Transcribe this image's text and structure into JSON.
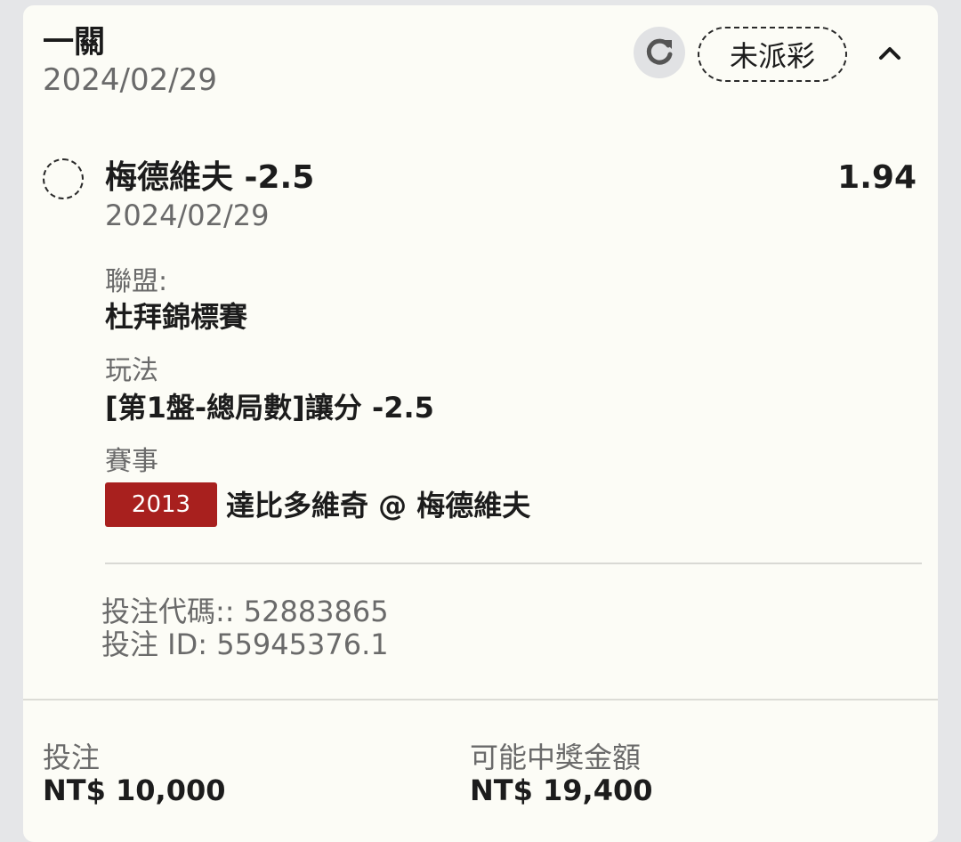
{
  "header": {
    "title": "一關",
    "date": "2024/02/29",
    "status": "未派彩",
    "refresh_icon": "refresh-icon",
    "collapse_icon": "chevron-up-icon"
  },
  "selection": {
    "name": "梅德維夫 -2.5",
    "date": "2024/02/29",
    "odds": "1.94",
    "league_label": "聯盟:",
    "league_value": "杜拜錦標賽",
    "market_label": "玩法",
    "market_value": "[第1盤-總局數]讓分 -2.5",
    "event_label": "賽事",
    "event_id": "2013",
    "event_name": "達比多維奇 @ 梅德維夫"
  },
  "bet_info": {
    "code_line": "投注代碼:: 52883865",
    "id_line": "投注 ID: 55945376.1"
  },
  "footer": {
    "stake_label": "投注",
    "stake_value": "NT$ 10,000",
    "payout_label": "可能中獎金額",
    "payout_value": "NT$ 19,400"
  },
  "colors": {
    "card_bg": "#fcfcf6",
    "page_bg": "#e5e6e8",
    "event_badge": "#a8201e",
    "muted_text": "#6a6a6a"
  }
}
